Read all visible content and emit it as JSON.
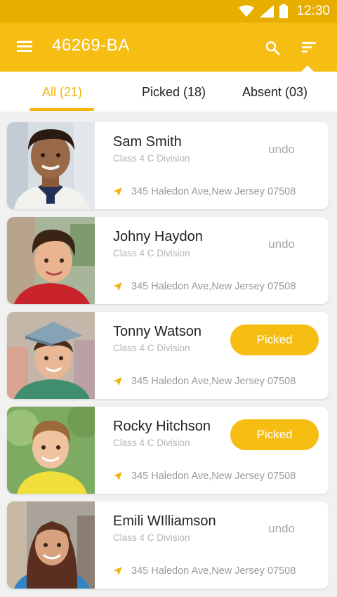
{
  "status_bar": {
    "time": "12:30"
  },
  "app_bar": {
    "title": "46269-BA"
  },
  "tabs": [
    {
      "label": "All (21)",
      "active": true
    },
    {
      "label": "Picked (18)",
      "active": false
    },
    {
      "label": "Absent (03)",
      "active": false
    }
  ],
  "students": [
    {
      "name": "Sam Smith",
      "class": "Class 4 C Division",
      "address": "345 Haledon Ave,New Jersey 07508",
      "action": "undo"
    },
    {
      "name": "Johny Haydon",
      "class": "Class 4 C Division",
      "address": "345 Haledon Ave,New Jersey 07508",
      "action": "undo"
    },
    {
      "name": "Tonny Watson",
      "class": "Class 4 C Division",
      "address": "345 Haledon Ave,New Jersey 07508",
      "action": "Picked"
    },
    {
      "name": "Rocky Hitchson",
      "class": "Class 4 C Division",
      "address": "345 Haledon Ave,New Jersey 07508",
      "action": "Picked"
    },
    {
      "name": "Emili WIlliamson",
      "class": "Class 4 C Division",
      "address": "345 Haledon Ave,New Jersey 07508",
      "action": "undo"
    }
  ],
  "colors": {
    "accent": "#f6bd12",
    "status_bar": "#e7ae00",
    "muted_text": "#b4b4b4"
  }
}
